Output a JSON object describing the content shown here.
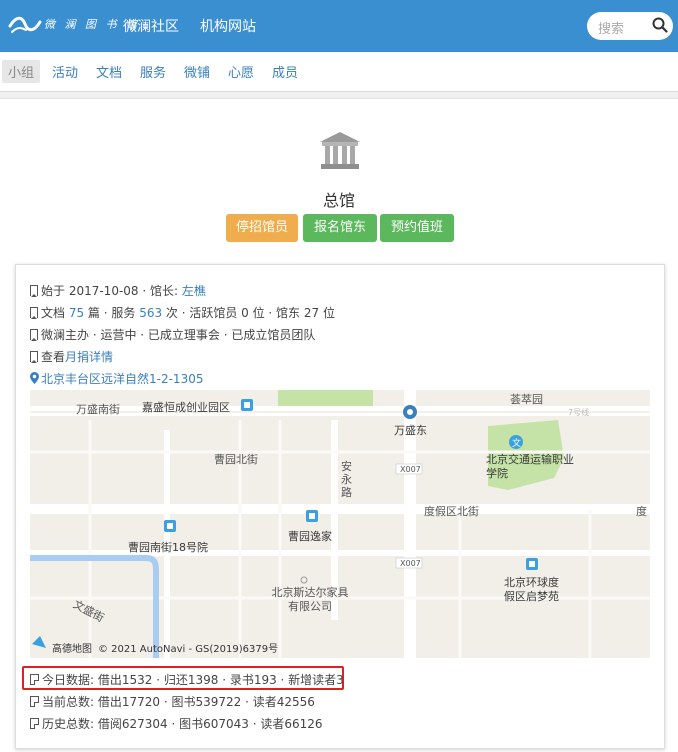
{
  "header": {
    "logo_text": "微 澜 图 书 馆",
    "nav": [
      "微澜社区",
      "机构网站"
    ],
    "search_placeholder": "搜索"
  },
  "tabs": [
    "小组",
    "活动",
    "文档",
    "服务",
    "微铺",
    "心愿",
    "成员"
  ],
  "group": {
    "title": "总馆",
    "buttons": [
      "停招馆员",
      "报名馆东",
      "预约值班"
    ]
  },
  "info": {
    "started_prefix": "始于 2017-10-08 · 馆长: ",
    "curator": "左樵",
    "docs_prefix": "文档 ",
    "docs_count": "75",
    "docs_mid": " 篇 · 服务 ",
    "services_count": "563",
    "docs_suffix": " 次 · 活跃馆员 0 位 · 馆东 27 位",
    "status": "微澜主办 · 运营中 · 已成立理事会 · 已成立馆员团队",
    "monthly_prefix": "查看",
    "monthly_link": "月捐详情",
    "address": "北京丰台区远洋自然1-2-1305"
  },
  "map": {
    "labels": {
      "wanshengnan": "万盛南街",
      "jiasheng": "嘉盛恒成创业园区",
      "wanshengdong": "万盛东",
      "qiaocuiyuan": "荟萃园",
      "line7": "7号线",
      "caoyuanbei": "曹园北街",
      "anyong": "安永路",
      "x007a": "X007",
      "x007b": "X007",
      "jiaotong": "北京交通运输职业学院",
      "dujiaqu": "度假区北街",
      "du": "度",
      "caoyuannan": "曹园南街18号院",
      "caoyuanyijia": "曹园逸家",
      "sidaer": "北京斯达尔家具有限公司",
      "huanqiu": "北京环球度假区启梦苑",
      "wensheng": "文盛街"
    },
    "brand": "高德地图",
    "copyright": "© 2021 AutoNavi - GS(2019)6379号"
  },
  "stats": {
    "today": "今日数据: 借出1532 · 归还1398 · 录书193 · 新增读者3",
    "current": "当前总数: 借出17720 · 图书539722 · 读者42556",
    "history": "历史总数: 借阅627304 · 图书607043 · 读者66126"
  },
  "colors": {
    "header": "#3a8fd0",
    "orange": "#f0ad4e",
    "green": "#5cb85c",
    "link": "#3a7fc0",
    "highlight": "#e02020"
  }
}
